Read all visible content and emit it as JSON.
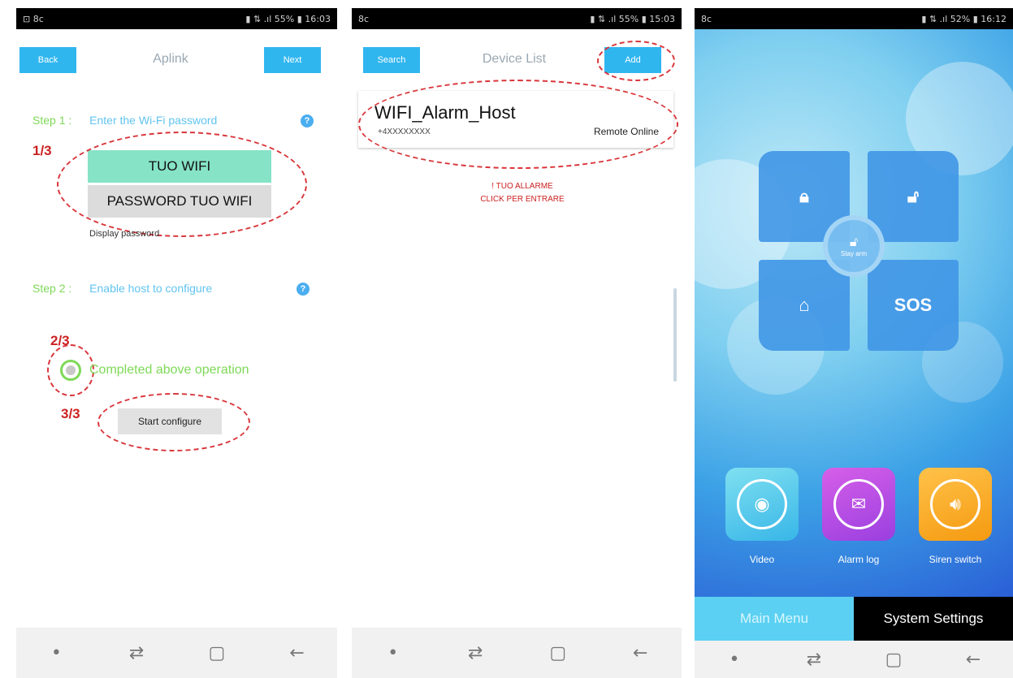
{
  "phone1": {
    "status": {
      "left": "⊡ 8c",
      "right": "▮ ⇅ .ıl 55% ▮ 16:03"
    },
    "back_label": "Back",
    "title": "Aplink",
    "next_label": "Next",
    "step1": {
      "label": "Step 1 :",
      "text": "Enter the Wi-Fi password"
    },
    "annot_1": "1/3",
    "wifi_ssid": "TUO WIFI",
    "wifi_password": "PASSWORD TUO WIFI",
    "display_password": "Display password",
    "step2": {
      "label": "Step 2 :",
      "text": "Enable host to configure"
    },
    "annot_2": "2/3",
    "completed_label": "Completed above operation",
    "annot_3": "3/3",
    "start_label": "Start configure"
  },
  "phone2": {
    "status": {
      "left": "8c",
      "right": "▮ ⇅ .ıl 55% ▮ 15:03"
    },
    "search_label": "Search",
    "title": "Device List",
    "add_label": "Add",
    "device_name": "WIFI_Alarm_Host",
    "device_id": "+4XXXXXXXX",
    "device_status": "Remote Online",
    "annot_line1": "! TUO ALLARME",
    "annot_line2": "CLICK PER ENTRARE"
  },
  "phone3": {
    "status": {
      "left": "8c",
      "right": "▮ ⇅ .ıl 52% ▮ 16:12"
    },
    "center_label": "Stay arm",
    "sos_label": "SOS",
    "video_label": "Video",
    "alarmlog_label": "Alarm log",
    "siren_label": "Siren switch",
    "tab_main": "Main Menu",
    "tab_settings": "System Settings"
  },
  "colors": {
    "accent": "#30b6ef",
    "field_green": "#86e3c6",
    "field_grey": "#dcdcdc",
    "annotation_red": "#d9363b"
  },
  "icons": [
    "lock-icon",
    "unlock-icon",
    "home-icon",
    "camera-icon",
    "chat-icon",
    "speaker-icon",
    "help-icon",
    "recent-apps-icon",
    "home-button-icon",
    "back-arrow-icon"
  ]
}
